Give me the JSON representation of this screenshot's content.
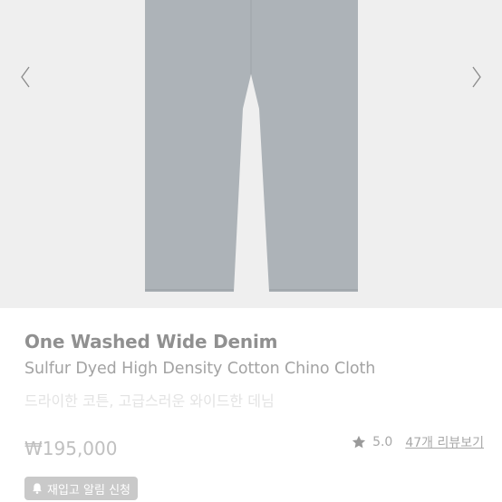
{
  "product": {
    "title": "One Washed Wide Denim",
    "subtitle": "Sulfur Dyed High Density Cotton Chino Cloth",
    "description": "드라이한 코튼, 고급스러운 와이드한 데님",
    "price": "₩195,000"
  },
  "rating": {
    "value": "5.0",
    "review_link": "47개 리뷰보기"
  },
  "restock": {
    "label": "재입고 알림 신청"
  },
  "icons": {
    "prev": "chevron-left-icon",
    "next": "chevron-right-icon",
    "rating": "star-icon",
    "restock": "bell-icon"
  },
  "colors": {
    "gallery_background": "#efefef",
    "pants": "#adb3b8",
    "button": "#c9c9c9"
  }
}
